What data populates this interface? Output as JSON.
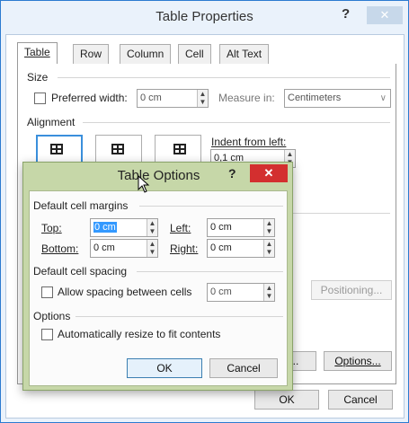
{
  "outer_dialog": {
    "title": "Table Properties",
    "help_label": "?",
    "close_label": "✕",
    "tabs": [
      {
        "label": "Table"
      },
      {
        "label": "Row"
      },
      {
        "label": "Column"
      },
      {
        "label": "Cell"
      },
      {
        "label": "Alt Text"
      }
    ],
    "size_section": "Size",
    "preferred_width_label": "Preferred width:",
    "preferred_width_value": "0 cm",
    "measure_in_label": "Measure in:",
    "measure_in_value": "Centimeters",
    "alignment_section": "Alignment",
    "indent_label": "Indent from left:",
    "indent_value": "0,1 cm",
    "positioning_button": "Positioning...",
    "borders_button_partial": "g...",
    "options_button": "Options...",
    "ok_button": "OK",
    "cancel_button": "Cancel"
  },
  "inner_dialog": {
    "title": "Table Options",
    "help_label": "?",
    "close_label": "✕",
    "margins_section": "Default cell margins",
    "top_label": "Top:",
    "top_value": "0 cm",
    "left_label": "Left:",
    "left_value": "0 cm",
    "bottom_label": "Bottom:",
    "bottom_value": "0 cm",
    "right_label": "Right:",
    "right_value": "0 cm",
    "spacing_section": "Default cell spacing",
    "allow_spacing_label": "Allow spacing between cells",
    "spacing_value": "0 cm",
    "options_section": "Options",
    "autoresize_label": "Automatically resize to fit contents",
    "ok_button": "OK",
    "cancel_button": "Cancel"
  },
  "colors": {
    "outer_border": "#2c7bd0",
    "inner_frame": "#c6d7a8",
    "close_red": "#d32f2f"
  }
}
